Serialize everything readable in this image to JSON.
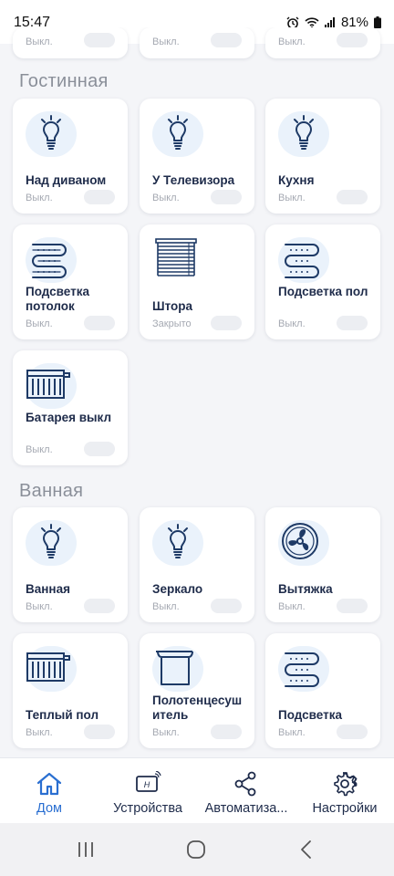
{
  "status": {
    "time": "15:47",
    "battery": "81%"
  },
  "top_row": [
    {
      "state": "Выкл."
    },
    {
      "state": "Выкл."
    },
    {
      "state": "Выкл."
    }
  ],
  "sections": [
    {
      "title": "Гостинная",
      "devices": [
        {
          "name": "Над диваном",
          "state": "Выкл.",
          "icon": "bulb-icon"
        },
        {
          "name": "У Телевизора",
          "state": "Выкл.",
          "icon": "bulb-icon"
        },
        {
          "name": "Кухня",
          "state": "Выкл.",
          "icon": "bulb-icon"
        },
        {
          "name": "Подсветка потолок",
          "state": "Выкл.",
          "icon": "led-strip-icon"
        },
        {
          "name": "Штора",
          "state": "Закрыто",
          "icon": "blinds-icon"
        },
        {
          "name": "Подсветка пол",
          "state": "Выкл.",
          "icon": "led-strip-icon"
        },
        {
          "name": "Батарея выкл",
          "state": "Выкл.",
          "icon": "radiator-icon"
        }
      ]
    },
    {
      "title": "Ванная",
      "devices": [
        {
          "name": "Ванная",
          "state": "Выкл.",
          "icon": "bulb-icon"
        },
        {
          "name": "Зеркало",
          "state": "Выкл.",
          "icon": "bulb-icon"
        },
        {
          "name": "Вытяжка",
          "state": "Выкл.",
          "icon": "fan-icon"
        },
        {
          "name": "Теплый пол",
          "state": "Выкл.",
          "icon": "radiator-icon"
        },
        {
          "name": "Полотенцесушитель",
          "state": "Выкл.",
          "icon": "towel-rail-icon"
        },
        {
          "name": "Подсветка",
          "state": "Выкл.",
          "icon": "led-strip-icon"
        }
      ]
    }
  ],
  "nav": [
    {
      "label": "Дом",
      "icon": "home-icon",
      "active": true
    },
    {
      "label": "Устройства",
      "icon": "device-icon",
      "active": false
    },
    {
      "label": "Автоматиза...",
      "icon": "share-icon",
      "active": false
    },
    {
      "label": "Настройки",
      "icon": "gear-icon",
      "active": false
    }
  ],
  "colors": {
    "accent": "#2a6fd1",
    "icon": "#1e3a66",
    "icon_bubble": "#eaf2fb"
  }
}
